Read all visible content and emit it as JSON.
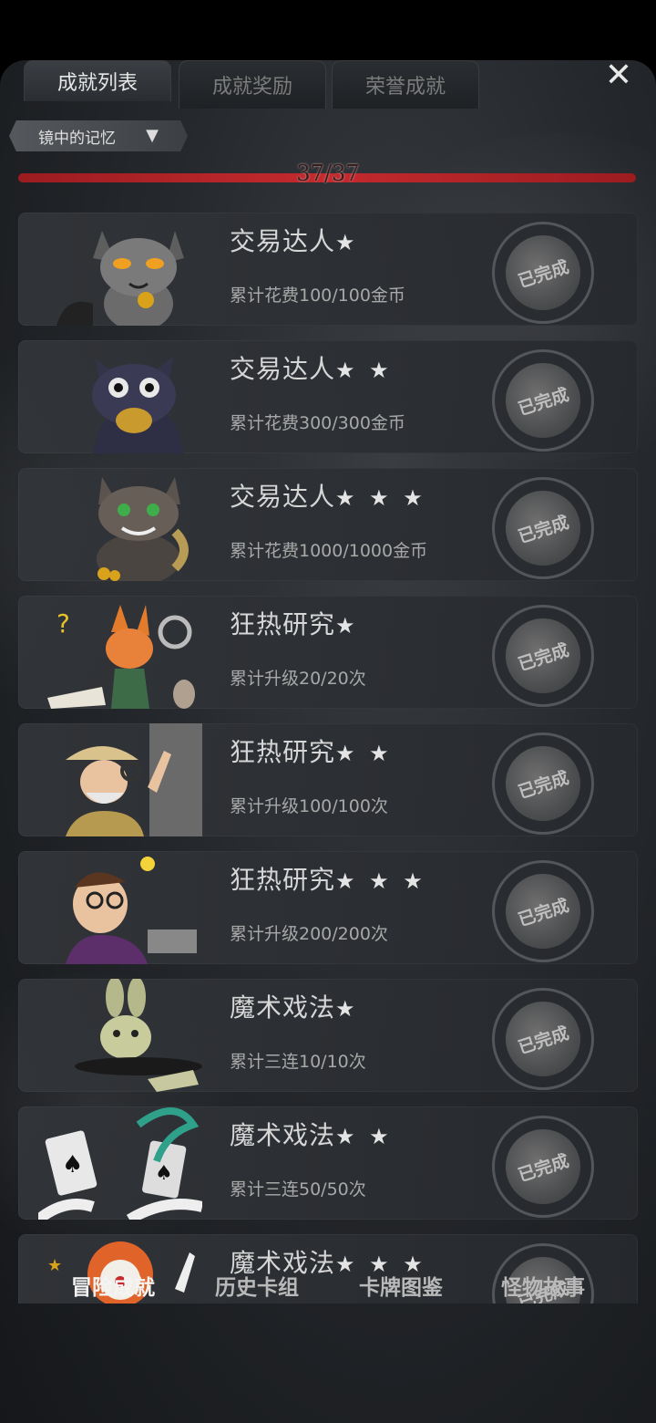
{
  "tabs": [
    {
      "label": "成就列表",
      "active": true
    },
    {
      "label": "成就奖励",
      "active": false
    },
    {
      "label": "荣誉成就",
      "active": false
    }
  ],
  "close_icon": "close-icon",
  "filter": {
    "label": "镜中的记忆",
    "icon": "funnel-icon"
  },
  "progress": {
    "text": "37/37",
    "fraction": 1.0,
    "color": "#c42a2e"
  },
  "achievements": [
    {
      "title": "交易达人",
      "stars": "★",
      "desc": "累计花费100/100金币",
      "status": "已完成"
    },
    {
      "title": "交易达人",
      "stars": "★ ★",
      "desc": "累计花费300/300金币",
      "status": "已完成"
    },
    {
      "title": "交易达人",
      "stars": "★ ★ ★",
      "desc": "累计花费1000/1000金币",
      "status": "已完成"
    },
    {
      "title": "狂热研究",
      "stars": "★",
      "desc": "累计升级20/20次",
      "status": "已完成"
    },
    {
      "title": "狂热研究",
      "stars": "★ ★",
      "desc": "累计升级100/100次",
      "status": "已完成"
    },
    {
      "title": "狂热研究",
      "stars": "★ ★ ★",
      "desc": "累计升级200/200次",
      "status": "已完成"
    },
    {
      "title": "魔术戏法",
      "stars": "★",
      "desc": "累计三连10/10次",
      "status": "已完成"
    },
    {
      "title": "魔术戏法",
      "stars": "★ ★",
      "desc": "累计三连50/50次",
      "status": "已完成"
    },
    {
      "title": "魔术戏法",
      "stars": "★ ★ ★",
      "desc": "",
      "status": "已完成"
    }
  ],
  "bottom_nav": [
    {
      "label": "冒险成就",
      "active": true
    },
    {
      "label": "历史卡组",
      "active": false
    },
    {
      "label": "卡牌图鉴",
      "active": false
    },
    {
      "label": "怪物故事",
      "active": false
    }
  ]
}
